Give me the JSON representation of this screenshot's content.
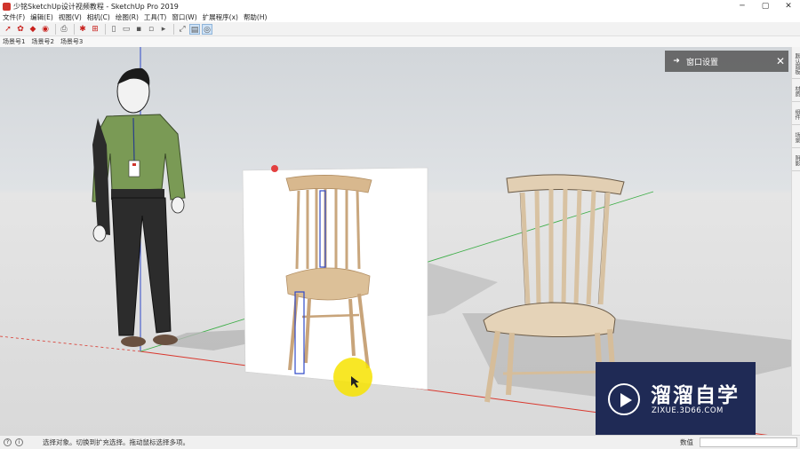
{
  "window": {
    "title": "少铭SketchUp设计视频教程 - SketchUp Pro 2019",
    "minimize_glyph": "─",
    "maximize_glyph": "▢",
    "close_glyph": "✕"
  },
  "menu": [
    "文件(F)",
    "编辑(E)",
    "视图(V)",
    "相机(C)",
    "绘图(R)",
    "工具(T)",
    "窗口(W)",
    "扩展程序(x)",
    "帮助(H)"
  ],
  "toolbar": {
    "icons": [
      "select-icon",
      "paint-icon",
      "eraser-icon",
      "camera-icon",
      "print-icon",
      "component-icon",
      "cube-icon",
      "top-view-icon",
      "front-view-icon",
      "right-view-icon",
      "back-view-icon",
      "left-view-icon",
      "axes-icon",
      "section-plane-icon",
      "section-fill-icon"
    ]
  },
  "scenes": [
    "场景号1",
    "场景号2",
    "场景号3"
  ],
  "panel": {
    "title": "窗口设置",
    "arrow_glyph": "➜",
    "close_glyph": "✕"
  },
  "tray_tabs": [
    "默认面板",
    "材质",
    "组件",
    "场景",
    "阴影"
  ],
  "watermark": {
    "title": "溜溜自学",
    "url": "ZIXUE.3D66.COM"
  },
  "status": {
    "text": "选择对象。切换到扩充选择。拖动鼠标选择多项。",
    "measure_label": "数值",
    "measure_value": ""
  },
  "colors": {
    "accent_red": "#d0342c",
    "axis_green": "#3fae49",
    "axis_red": "#d9372d",
    "axis_blue": "#2f49c9",
    "wood": "#ddc4a3",
    "highlight": "#f7e300",
    "watermark_bg": "#1f2a55"
  }
}
